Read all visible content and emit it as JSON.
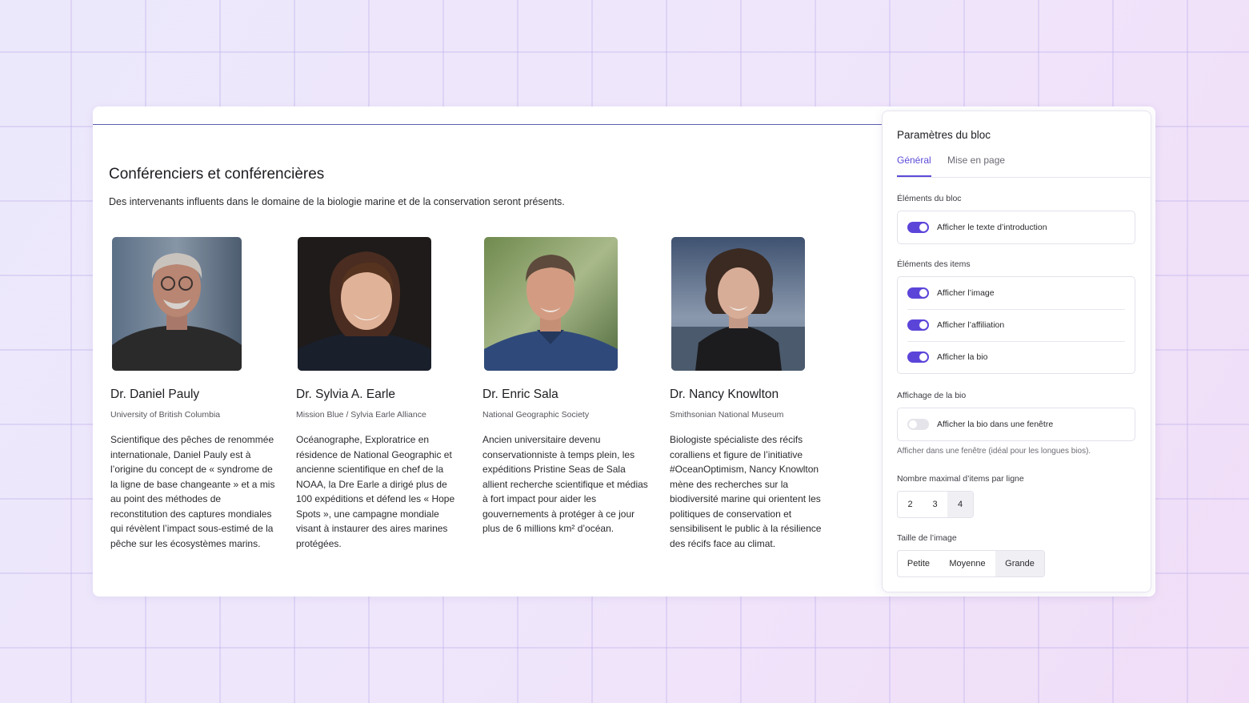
{
  "block": {
    "title": "Conférenciers et conférencières",
    "intro": "Des intervenants influents dans le domaine de la biologie marine et de la conservation seront présents."
  },
  "speakers": [
    {
      "name": "Dr. Daniel Pauly",
      "affiliation": "University of British Columbia",
      "bio": "Scientifique des pêches de renommée internationale, Daniel Pauly est à l’origine du concept de « syndrome de la ligne de base changeante » et a mis au point des méthodes de reconstitution des captures mondiales qui révèlent l’impact sous-estimé de la pêche sur les écosystèmes marins."
    },
    {
      "name": "Dr. Sylvia A. Earle",
      "affiliation": "Mission Blue / Sylvia Earle Alliance",
      "bio": "Océanographe, Exploratrice en résidence de National Geographic et ancienne scientifique en chef de la NOAA, la Dre Earle a dirigé plus de 100 expéditions et défend les « Hope Spots », une campagne mondiale visant à instaurer des aires marines protégées."
    },
    {
      "name": "Dr. Enric Sala",
      "affiliation": "National Geographic Society",
      "bio": "Ancien universitaire devenu conservationniste à temps plein, les expéditions Pristine Seas de Sala allient recherche scientifique et médias à fort impact pour aider les gouvernements à protéger à ce jour plus de 6 millions km² d’océan."
    },
    {
      "name": "Dr. Nancy Knowlton",
      "affiliation": "Smithsonian National Museum",
      "bio": "Biologiste spécialiste des récifs coralliens et figure de l’initiative #OceanOptimism, Nancy Knowlton mène des recherches sur la biodiversité marine qui orientent les politiques de conservation et sensibilisent le public à la résilience des récifs face au climat."
    }
  ],
  "panel": {
    "title": "Paramètres du bloc",
    "tabs": [
      {
        "label": "Général",
        "active": true
      },
      {
        "label": "Mise en page",
        "active": false
      }
    ],
    "block_elements": {
      "label": "Éléments du bloc",
      "items": [
        {
          "label": "Afficher le texte d’introduction",
          "on": true
        }
      ]
    },
    "item_elements": {
      "label": "Éléments des items",
      "items": [
        {
          "label": "Afficher l’image",
          "on": true
        },
        {
          "label": "Afficher l’affiliation",
          "on": true
        },
        {
          "label": "Afficher la bio",
          "on": true
        }
      ]
    },
    "bio_display": {
      "label": "Affichage de la bio",
      "items": [
        {
          "label": "Afficher la bio dans une fenêtre",
          "on": false
        }
      ],
      "helper": "Afficher dans une fenêtre (idéal pour les longues bios)."
    },
    "max_items": {
      "label": "Nombre maximal d’items par ligne",
      "options": [
        "2",
        "3",
        "4"
      ],
      "selected": "4"
    },
    "image_size": {
      "label": "Taille de l’image",
      "options": [
        "Petite",
        "Moyenne",
        "Grande"
      ],
      "selected": "Grande"
    }
  },
  "colors": {
    "accent": "#5b45d9",
    "toggle_off": "#e5e4ea",
    "background": "#efe9fb"
  }
}
